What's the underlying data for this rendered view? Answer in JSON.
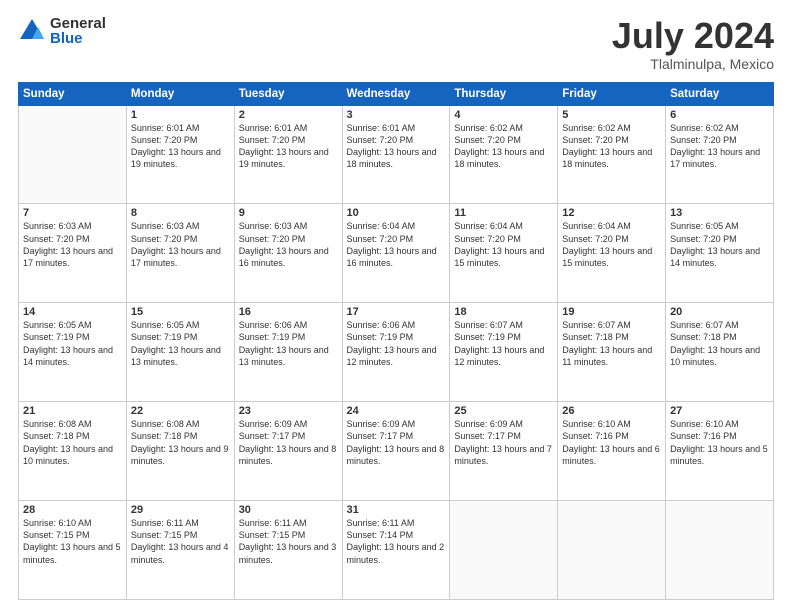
{
  "logo": {
    "general": "General",
    "blue": "Blue"
  },
  "header": {
    "month_year": "July 2024",
    "location": "Tlalminulpa, Mexico"
  },
  "weekdays": [
    "Sunday",
    "Monday",
    "Tuesday",
    "Wednesday",
    "Thursday",
    "Friday",
    "Saturday"
  ],
  "weeks": [
    [
      {
        "day": "",
        "empty": true
      },
      {
        "day": "1",
        "sunrise": "6:01 AM",
        "sunset": "7:20 PM",
        "daylight": "13 hours and 19 minutes."
      },
      {
        "day": "2",
        "sunrise": "6:01 AM",
        "sunset": "7:20 PM",
        "daylight": "13 hours and 19 minutes."
      },
      {
        "day": "3",
        "sunrise": "6:01 AM",
        "sunset": "7:20 PM",
        "daylight": "13 hours and 18 minutes."
      },
      {
        "day": "4",
        "sunrise": "6:02 AM",
        "sunset": "7:20 PM",
        "daylight": "13 hours and 18 minutes."
      },
      {
        "day": "5",
        "sunrise": "6:02 AM",
        "sunset": "7:20 PM",
        "daylight": "13 hours and 18 minutes."
      },
      {
        "day": "6",
        "sunrise": "6:02 AM",
        "sunset": "7:20 PM",
        "daylight": "13 hours and 17 minutes."
      }
    ],
    [
      {
        "day": "7",
        "sunrise": "6:03 AM",
        "sunset": "7:20 PM",
        "daylight": "13 hours and 17 minutes."
      },
      {
        "day": "8",
        "sunrise": "6:03 AM",
        "sunset": "7:20 PM",
        "daylight": "13 hours and 17 minutes."
      },
      {
        "day": "9",
        "sunrise": "6:03 AM",
        "sunset": "7:20 PM",
        "daylight": "13 hours and 16 minutes."
      },
      {
        "day": "10",
        "sunrise": "6:04 AM",
        "sunset": "7:20 PM",
        "daylight": "13 hours and 16 minutes."
      },
      {
        "day": "11",
        "sunrise": "6:04 AM",
        "sunset": "7:20 PM",
        "daylight": "13 hours and 15 minutes."
      },
      {
        "day": "12",
        "sunrise": "6:04 AM",
        "sunset": "7:20 PM",
        "daylight": "13 hours and 15 minutes."
      },
      {
        "day": "13",
        "sunrise": "6:05 AM",
        "sunset": "7:20 PM",
        "daylight": "13 hours and 14 minutes."
      }
    ],
    [
      {
        "day": "14",
        "sunrise": "6:05 AM",
        "sunset": "7:19 PM",
        "daylight": "13 hours and 14 minutes."
      },
      {
        "day": "15",
        "sunrise": "6:05 AM",
        "sunset": "7:19 PM",
        "daylight": "13 hours and 13 minutes."
      },
      {
        "day": "16",
        "sunrise": "6:06 AM",
        "sunset": "7:19 PM",
        "daylight": "13 hours and 13 minutes."
      },
      {
        "day": "17",
        "sunrise": "6:06 AM",
        "sunset": "7:19 PM",
        "daylight": "13 hours and 12 minutes."
      },
      {
        "day": "18",
        "sunrise": "6:07 AM",
        "sunset": "7:19 PM",
        "daylight": "13 hours and 12 minutes."
      },
      {
        "day": "19",
        "sunrise": "6:07 AM",
        "sunset": "7:18 PM",
        "daylight": "13 hours and 11 minutes."
      },
      {
        "day": "20",
        "sunrise": "6:07 AM",
        "sunset": "7:18 PM",
        "daylight": "13 hours and 10 minutes."
      }
    ],
    [
      {
        "day": "21",
        "sunrise": "6:08 AM",
        "sunset": "7:18 PM",
        "daylight": "13 hours and 10 minutes."
      },
      {
        "day": "22",
        "sunrise": "6:08 AM",
        "sunset": "7:18 PM",
        "daylight": "13 hours and 9 minutes."
      },
      {
        "day": "23",
        "sunrise": "6:09 AM",
        "sunset": "7:17 PM",
        "daylight": "13 hours and 8 minutes."
      },
      {
        "day": "24",
        "sunrise": "6:09 AM",
        "sunset": "7:17 PM",
        "daylight": "13 hours and 8 minutes."
      },
      {
        "day": "25",
        "sunrise": "6:09 AM",
        "sunset": "7:17 PM",
        "daylight": "13 hours and 7 minutes."
      },
      {
        "day": "26",
        "sunrise": "6:10 AM",
        "sunset": "7:16 PM",
        "daylight": "13 hours and 6 minutes."
      },
      {
        "day": "27",
        "sunrise": "6:10 AM",
        "sunset": "7:16 PM",
        "daylight": "13 hours and 5 minutes."
      }
    ],
    [
      {
        "day": "28",
        "sunrise": "6:10 AM",
        "sunset": "7:15 PM",
        "daylight": "13 hours and 5 minutes."
      },
      {
        "day": "29",
        "sunrise": "6:11 AM",
        "sunset": "7:15 PM",
        "daylight": "13 hours and 4 minutes."
      },
      {
        "day": "30",
        "sunrise": "6:11 AM",
        "sunset": "7:15 PM",
        "daylight": "13 hours and 3 minutes."
      },
      {
        "day": "31",
        "sunrise": "6:11 AM",
        "sunset": "7:14 PM",
        "daylight": "13 hours and 2 minutes."
      },
      {
        "day": "",
        "empty": true
      },
      {
        "day": "",
        "empty": true
      },
      {
        "day": "",
        "empty": true
      }
    ]
  ]
}
